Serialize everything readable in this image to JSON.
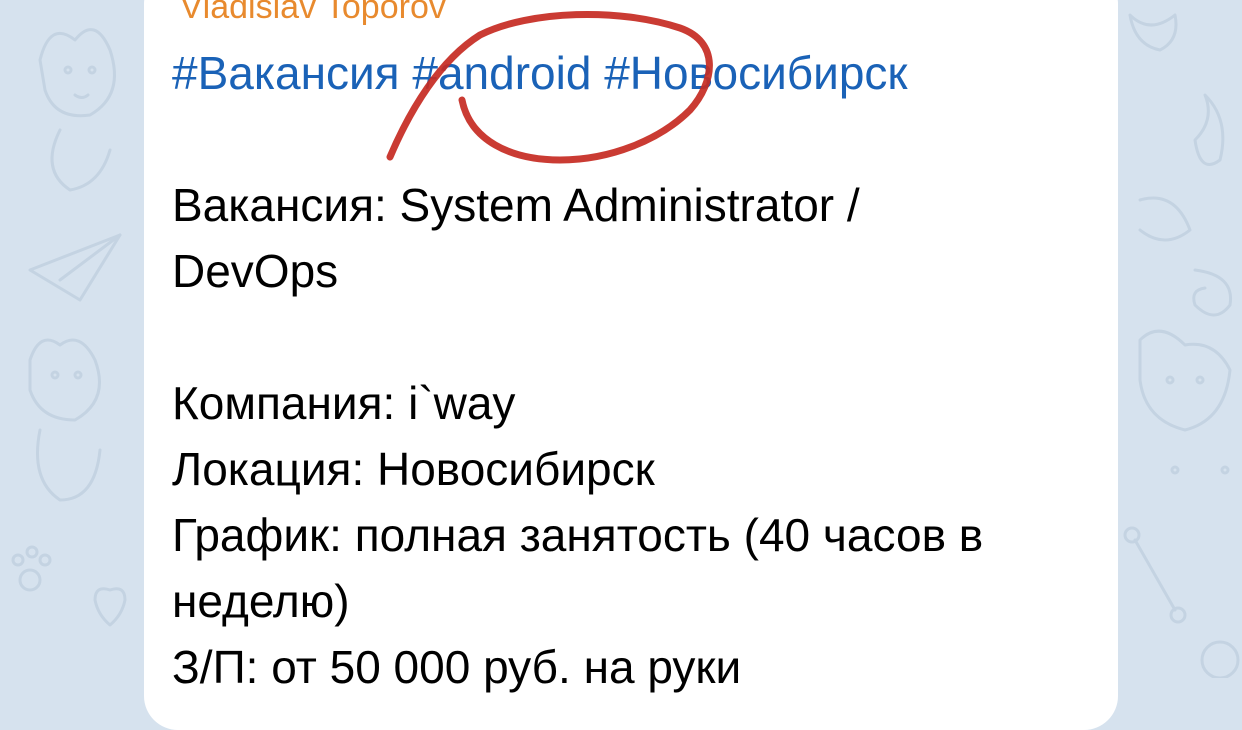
{
  "message": {
    "sender": "Vladislav Toporov",
    "hashtags": [
      "#Вакансия",
      "#android",
      "#Новосибирск"
    ],
    "lines": [
      "Вакансия: System Administrator /",
      "DevOps",
      "",
      "Компания: i`way",
      "Локация: Новосибирск",
      "График: полная занятость (40 часов в",
      "неделю)",
      "З/П: от 50 000 руб. на руки"
    ]
  },
  "colors": {
    "sender": "#e88a2e",
    "hashtag": "#1a62b7",
    "annotation": "#c62a22",
    "background": "#d6e2ee"
  },
  "annotation": {
    "icon": "red-freehand-circle-icon"
  }
}
